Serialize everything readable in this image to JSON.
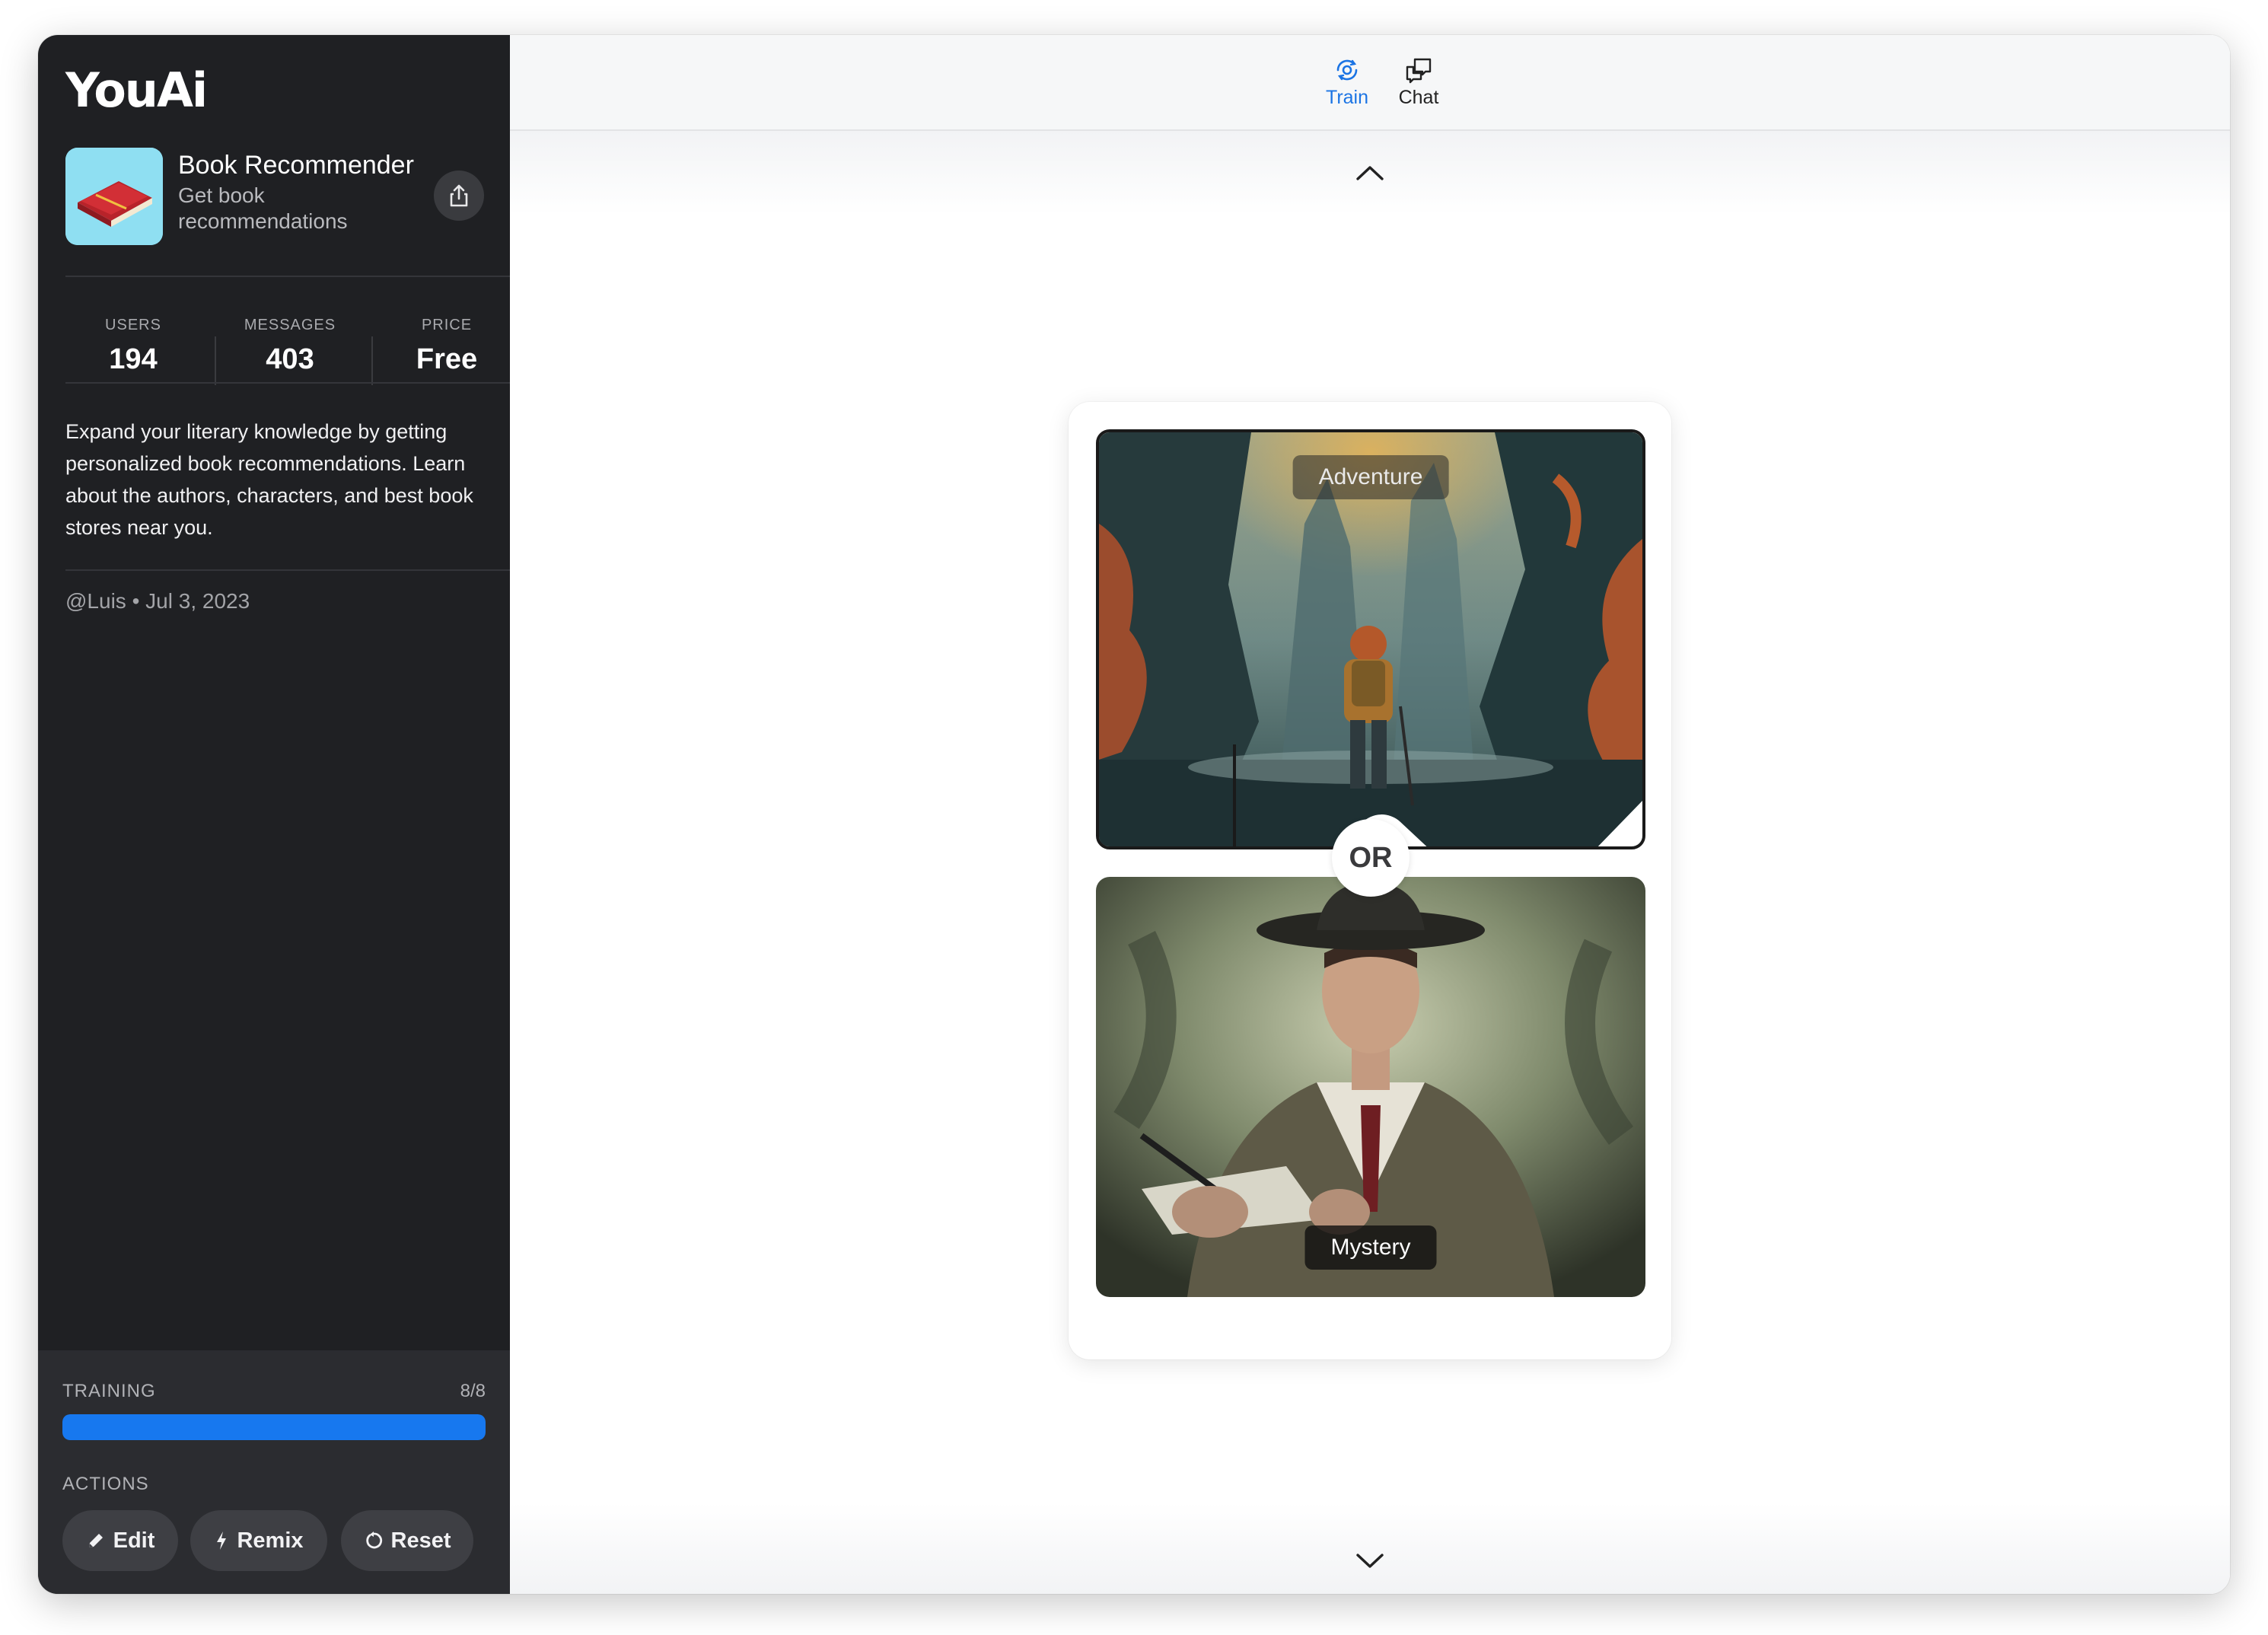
{
  "brand": "YouAi",
  "app": {
    "name": "Book Recommender",
    "subtitle": "Get book recommendations",
    "description": "Expand your literary knowledge by getting personalized book recommendations. Learn about the authors, characters, and best book stores near you.",
    "author": "@Luis",
    "date": "Jul 3, 2023",
    "meta_separator": "•"
  },
  "stats": [
    {
      "label": "USERS",
      "value": "194"
    },
    {
      "label": "MESSAGES",
      "value": "403"
    },
    {
      "label": "PRICE",
      "value": "Free"
    }
  ],
  "training": {
    "label": "TRAINING",
    "count": "8/8",
    "progress_fraction": 1.0
  },
  "actions": {
    "label": "ACTIONS",
    "edit": "Edit",
    "remix": "Remix",
    "reset": "Reset"
  },
  "tabs": {
    "train": "Train",
    "chat": "Chat",
    "active": "train"
  },
  "choice": {
    "option_a": "Adventure",
    "option_b": "Mystery",
    "or_label": "OR",
    "selected": "option_a"
  },
  "colors": {
    "sidebar_bg": "#1f2023",
    "accent": "#1778ef",
    "active_tab": "#1b74e4"
  },
  "icons": {
    "share": "share-icon",
    "train_tab": "train-icon",
    "chat_tab": "chat-icon",
    "scroll_up": "chevron-up-icon",
    "scroll_down": "chevron-down-icon",
    "edit": "pencil-icon",
    "remix": "bolt-icon",
    "reset": "reset-icon",
    "selected": "checkmark-icon"
  }
}
